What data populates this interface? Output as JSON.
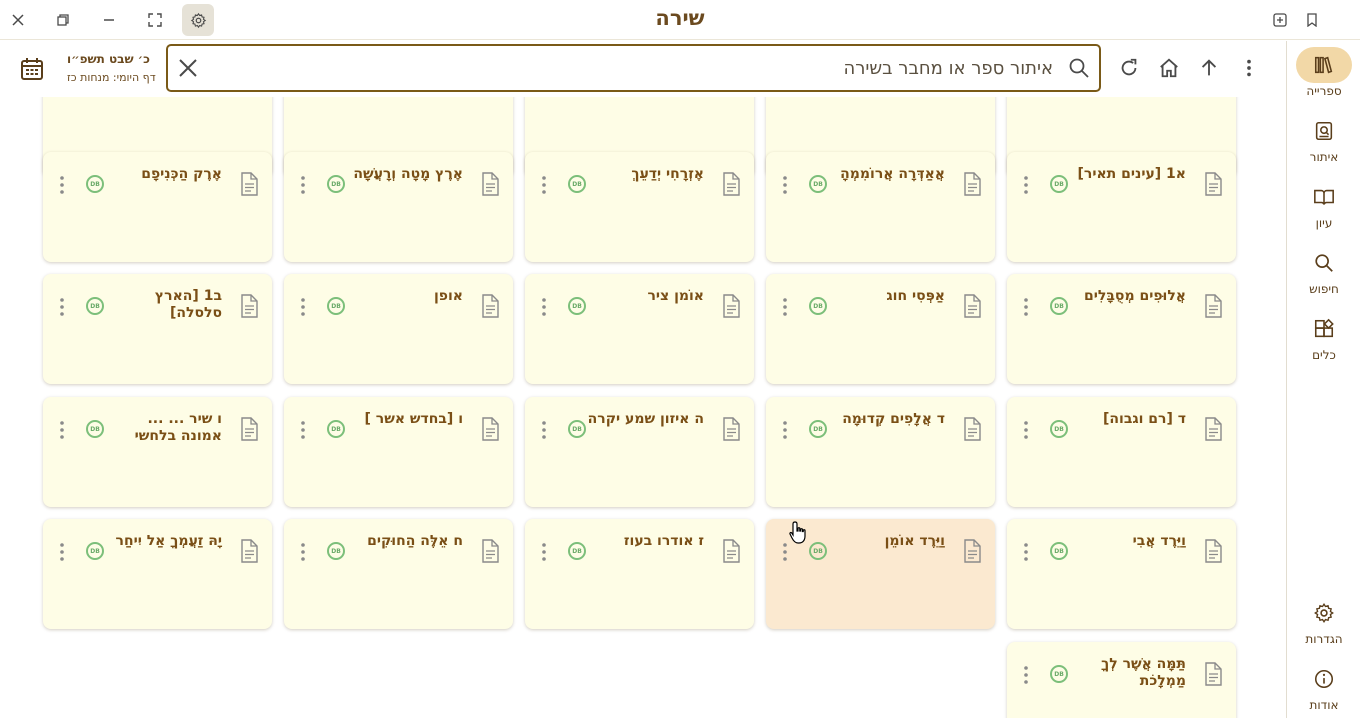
{
  "app": {
    "title": "שירה",
    "window_icons": [
      "close-icon",
      "restore-icon",
      "minimize-icon",
      "fullscreen-icon",
      "gear-icon",
      "new-tab-icon",
      "bookmark-icon"
    ]
  },
  "toolbar": {
    "date": "כ׳ שבט תשפ״ו",
    "daf_yomi": "דף היומי: מנחות כז",
    "search_placeholder": "איתור ספר או מחבר בשירה",
    "icons": [
      "calendar-icon",
      "clear-icon",
      "search-icon",
      "refresh-icon",
      "home-icon",
      "up-arrow-icon",
      "more-vertical-icon"
    ]
  },
  "sidebar": {
    "items": [
      {
        "label": "ספרייה",
        "icon": "library-icon",
        "active": true
      },
      {
        "label": "איתור",
        "icon": "find-book-icon",
        "active": false
      },
      {
        "label": "עיון",
        "icon": "open-book-icon",
        "active": false
      },
      {
        "label": "חיפוש",
        "icon": "search-icon",
        "active": false
      },
      {
        "label": "כלים",
        "icon": "tools-icon",
        "active": false
      }
    ],
    "bottom": [
      {
        "label": "הגדרות",
        "icon": "gear-icon"
      },
      {
        "label": "אודות",
        "icon": "info-icon"
      }
    ]
  },
  "books": {
    "row0": [
      "",
      "",
      "",
      "",
      ""
    ],
    "row1": [
      "א1 [עינים תאיר]",
      "אֲאַדְּרָה אֲרוֹמִמְהָ",
      "אֶזְרָחִי יְדַעֵךְ",
      "אֶרֶץ מָטָה וְרָעֲשָׁה",
      "אֶרֶק הַכְּנִיפָם"
    ],
    "row2": [
      "אֲלוּפִים מְסֻבָּלִים",
      "אַפְּסִי חוג",
      "אוֹמן ציר",
      "אופן",
      "ב1 [הארץ סלסלה]"
    ],
    "row3": [
      "ד [רם וגבוה]",
      "ד אֲלָפִים קְדוּמָה",
      "ה איזון שמע יקרה",
      "ו [בחדש אשר ]",
      "ו שיר ... ... אמונה בלחשי"
    ],
    "row4": [
      "וַיֵּרֶד אֲבִי",
      "וַיֵּרֶד אוֹמֵן",
      "ז אודרו בעוז",
      "ח אֵלֶּה הַחוּקִים",
      "יָהּ זַעֲמְךָ אַל יִיחַר"
    ],
    "row5": [
      "תַּמָּה אֲשֶׁר לְךָ מַמְלָכֹת"
    ],
    "db_badge": "DB"
  }
}
